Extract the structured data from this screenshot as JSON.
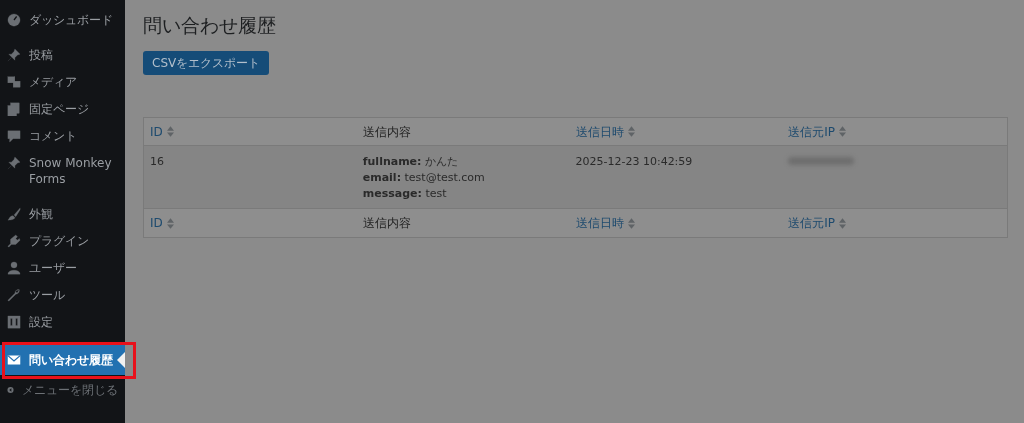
{
  "sidebar": {
    "groups": [
      [
        {
          "kind": "dashboard",
          "label": "ダッシュボード",
          "selected": false,
          "highlighted": false
        }
      ],
      [
        {
          "kind": "pin",
          "label": "投稿",
          "selected": false,
          "highlighted": false
        },
        {
          "kind": "media",
          "label": "メディア",
          "selected": false,
          "highlighted": false
        },
        {
          "kind": "pages",
          "label": "固定ページ",
          "selected": false,
          "highlighted": false
        },
        {
          "kind": "comment",
          "label": "コメント",
          "selected": false,
          "highlighted": false
        },
        {
          "kind": "pin",
          "label": "Snow Monkey Forms",
          "selected": false,
          "highlighted": false
        }
      ],
      [
        {
          "kind": "brush",
          "label": "外観",
          "selected": false,
          "highlighted": false
        },
        {
          "kind": "plugin",
          "label": "プラグイン",
          "selected": false,
          "highlighted": false
        },
        {
          "kind": "user",
          "label": "ユーザー",
          "selected": false,
          "highlighted": false
        },
        {
          "kind": "wrench",
          "label": "ツール",
          "selected": false,
          "highlighted": false
        },
        {
          "kind": "settings",
          "label": "設定",
          "selected": false,
          "highlighted": false
        }
      ],
      [
        {
          "kind": "mail",
          "label": "問い合わせ履歴",
          "selected": true,
          "highlighted": true
        }
      ]
    ],
    "collapse": {
      "label": "メニューを閉じる"
    }
  },
  "page_title": "問い合わせ履歴",
  "export_button": "CSVをエクスポート",
  "table": {
    "columns": [
      {
        "label": "ID",
        "sortable": true
      },
      {
        "label": "送信内容",
        "sortable": false
      },
      {
        "label": "送信日時",
        "sortable": true
      },
      {
        "label": "送信元IP",
        "sortable": true
      }
    ],
    "rows": [
      {
        "id": "16",
        "content": [
          "**fullname:** かんた",
          "**email:** test@test.com",
          "**message:** test"
        ],
        "date": "2025-12-23 10:42:59",
        "ip_blurred": true
      }
    ],
    "footer_columns": [
      {
        "label": "ID",
        "sortable": true
      },
      {
        "label": "送信内容",
        "sortable": false
      },
      {
        "label": "送信日時",
        "sortable": true
      },
      {
        "label": "送信元IP",
        "sortable": true
      }
    ]
  }
}
